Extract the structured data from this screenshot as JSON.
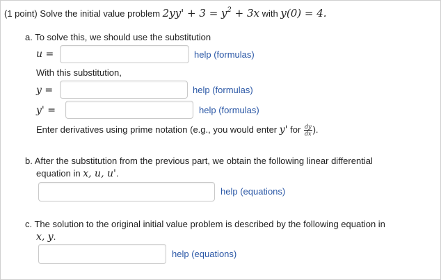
{
  "problem": {
    "points": "(1 point)",
    "intro": "Solve the initial value problem",
    "equation": "2yy' + 3 = y",
    "equation_exp": "2",
    "equation_tail": " + 3x",
    "with_word": "with",
    "initial_condition": "y(0) = 4."
  },
  "part_a": {
    "prompt": "a. To solve this, we should use the substitution",
    "u_label": "u =",
    "u_value": "",
    "u_help": "help (formulas)",
    "with_sub": "With this substitution,",
    "y_label": "y =",
    "y_value": "",
    "y_help": "help (formulas)",
    "yprime_label": "y' =",
    "yprime_value": "",
    "yprime_help": "help (formulas)",
    "deriv_note": "Enter derivatives using prime notation (e.g., you would enter",
    "deriv_yprime": "y'",
    "deriv_for": "for",
    "frac_num": "dy",
    "frac_den": "dx",
    "deriv_end": ")."
  },
  "part_b": {
    "prompt_line1": "b. After the substitution from the previous part, we obtain the following linear differential",
    "prompt_line2_text": "equation in",
    "prompt_line2_vars": "x, u, u'",
    "prompt_line2_end": ".",
    "value": "",
    "help": "help (equations)"
  },
  "part_c": {
    "prompt_line1": "c. The solution to the original initial value problem is described by the following equation in",
    "prompt_line2_vars": "x, y",
    "prompt_line2_end": ".",
    "value": "",
    "help": "help (equations)"
  }
}
